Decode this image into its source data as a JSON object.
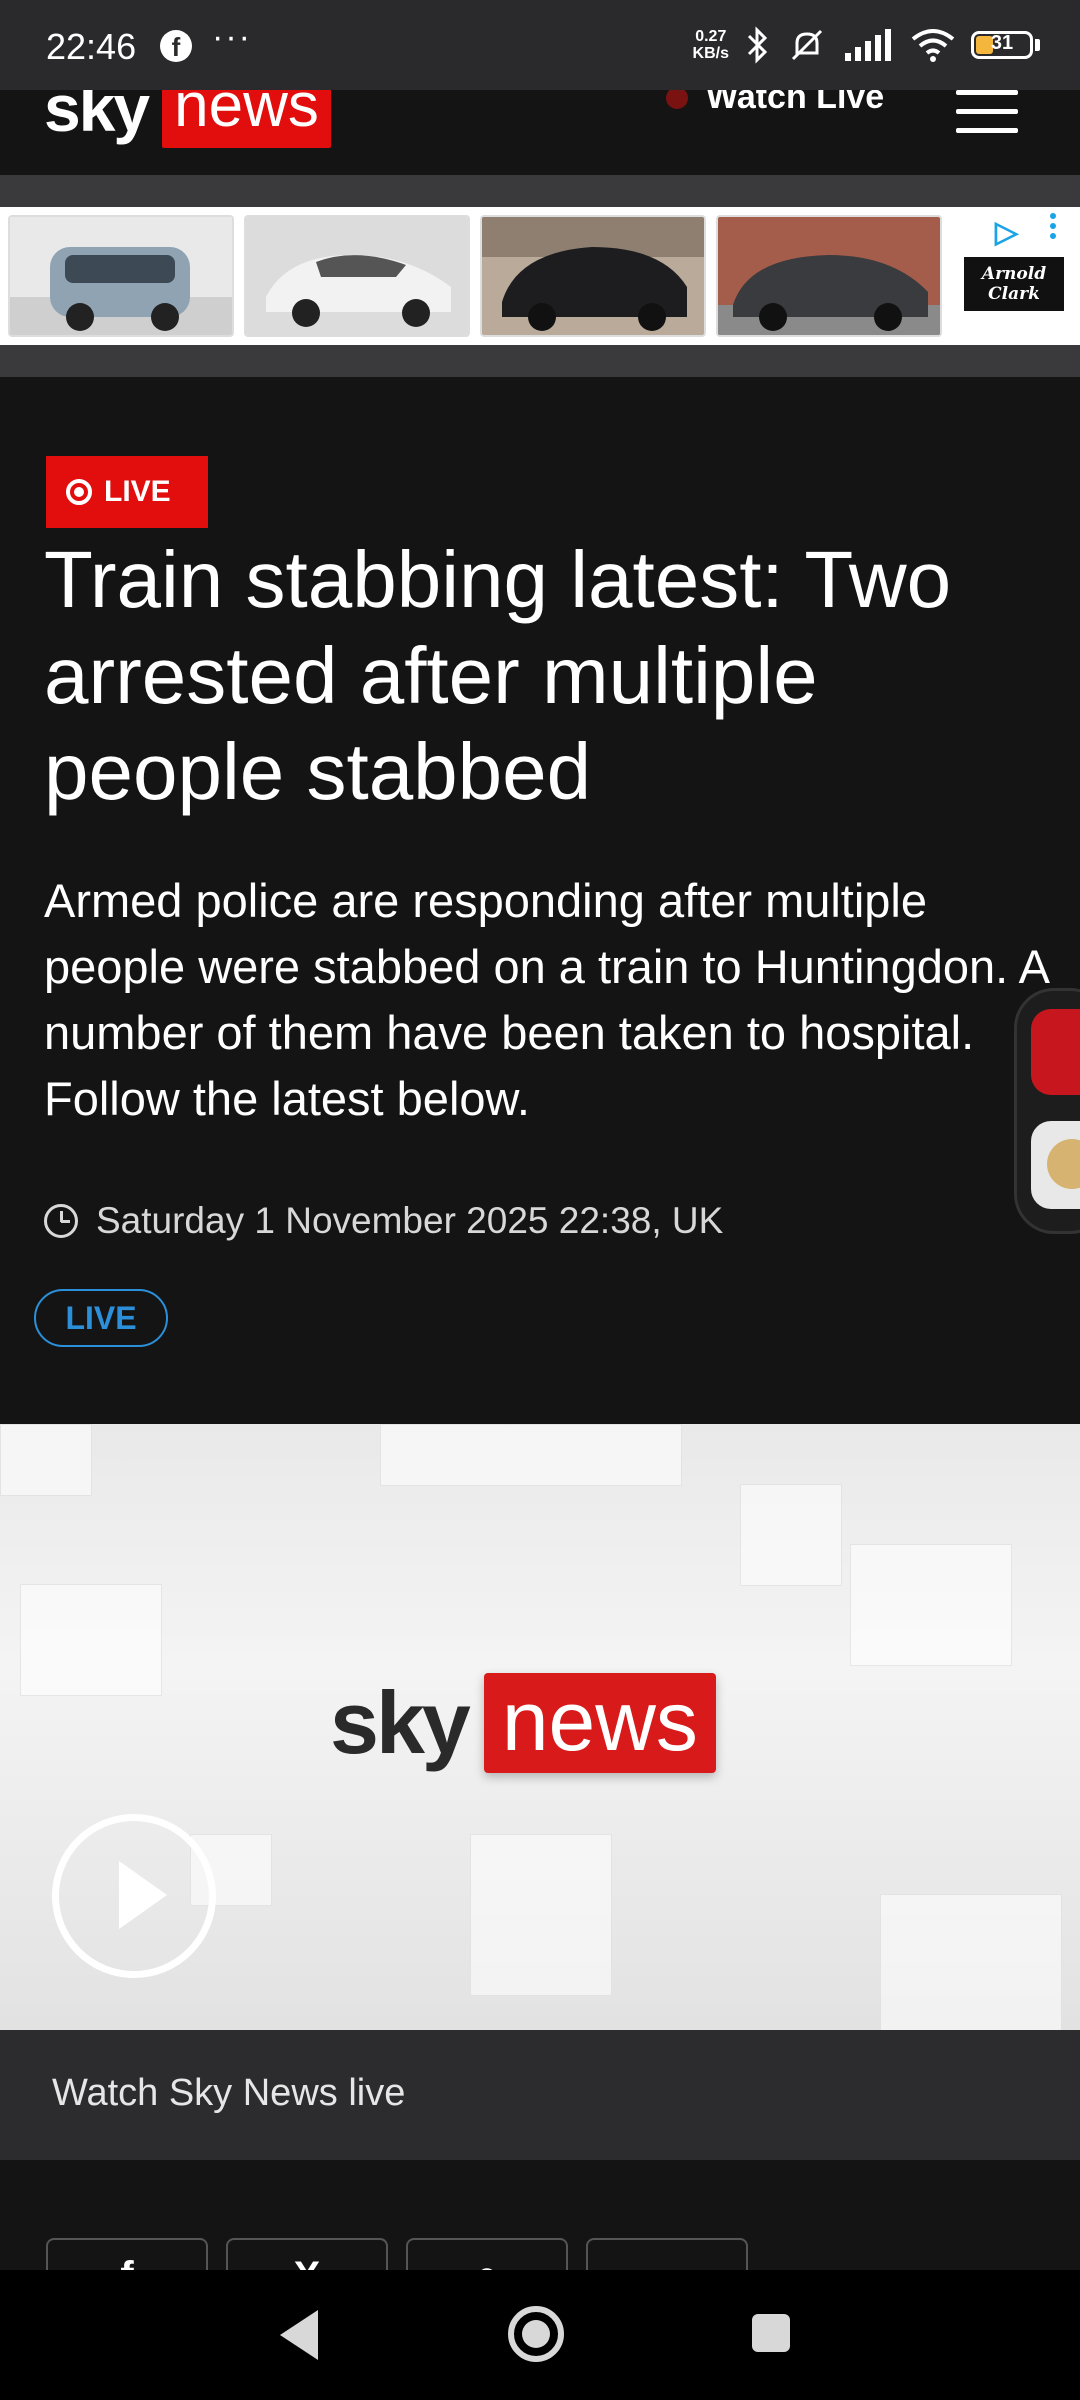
{
  "status_bar": {
    "time": "22:46",
    "facebook_icon": "f",
    "more": "···",
    "net_speed_value": "0.27",
    "net_speed_unit": "KB/s",
    "battery": "31"
  },
  "header": {
    "logo_sky": "sky",
    "logo_news": "news",
    "watch_live": "Watch Live"
  },
  "ad": {
    "brand": "Arnold Clark",
    "ad_choice_icon": "▷"
  },
  "article": {
    "badge": "LIVE",
    "headline": "Train stabbing latest: Two arrested after multiple people stabbed",
    "standfirst": "Armed police are responding after multiple people were stabbed on a train to Huntingdon. A number of them have been taken to hospital. Follow the latest below.",
    "timestamp": "Saturday 1 November 2025 22:38, UK",
    "live_pill": "LIVE"
  },
  "video": {
    "logo_sky": "sky",
    "logo_news": "news",
    "caption": "Watch Sky News live"
  },
  "colors": {
    "brand_red": "#e20d0d",
    "live_blue": "#2b90d9",
    "background": "#141414"
  }
}
